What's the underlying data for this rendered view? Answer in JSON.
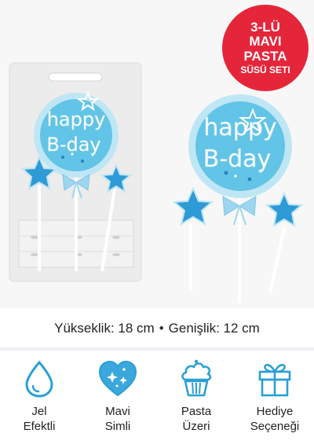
{
  "badge": {
    "line1": "3-LÜ",
    "line2": "MAVI",
    "line3": "PASTA",
    "line4": "SÜSÜ SETI",
    "color": "#e5263a"
  },
  "product": {
    "topper_text_line1": "happy",
    "topper_text_line2": "B-day",
    "accent_color": "#7cc9e8",
    "star_color": "#2e9ad6"
  },
  "dimensions": {
    "height": "Yükseklik: 18 cm",
    "separator": "•",
    "width": "Genişlik: 12 cm"
  },
  "features": [
    {
      "icon": "water-drop-icon",
      "line1": "Jel",
      "line2": "Efektli"
    },
    {
      "icon": "heart-sparkle-icon",
      "line1": "Mavi",
      "line2": "Simli"
    },
    {
      "icon": "cupcake-icon",
      "line1": "Pasta",
      "line2": "Üzeri"
    },
    {
      "icon": "gift-icon",
      "line1": "Hediye",
      "line2": "Seçeneği"
    }
  ],
  "icon_color": "#2a9fd6"
}
